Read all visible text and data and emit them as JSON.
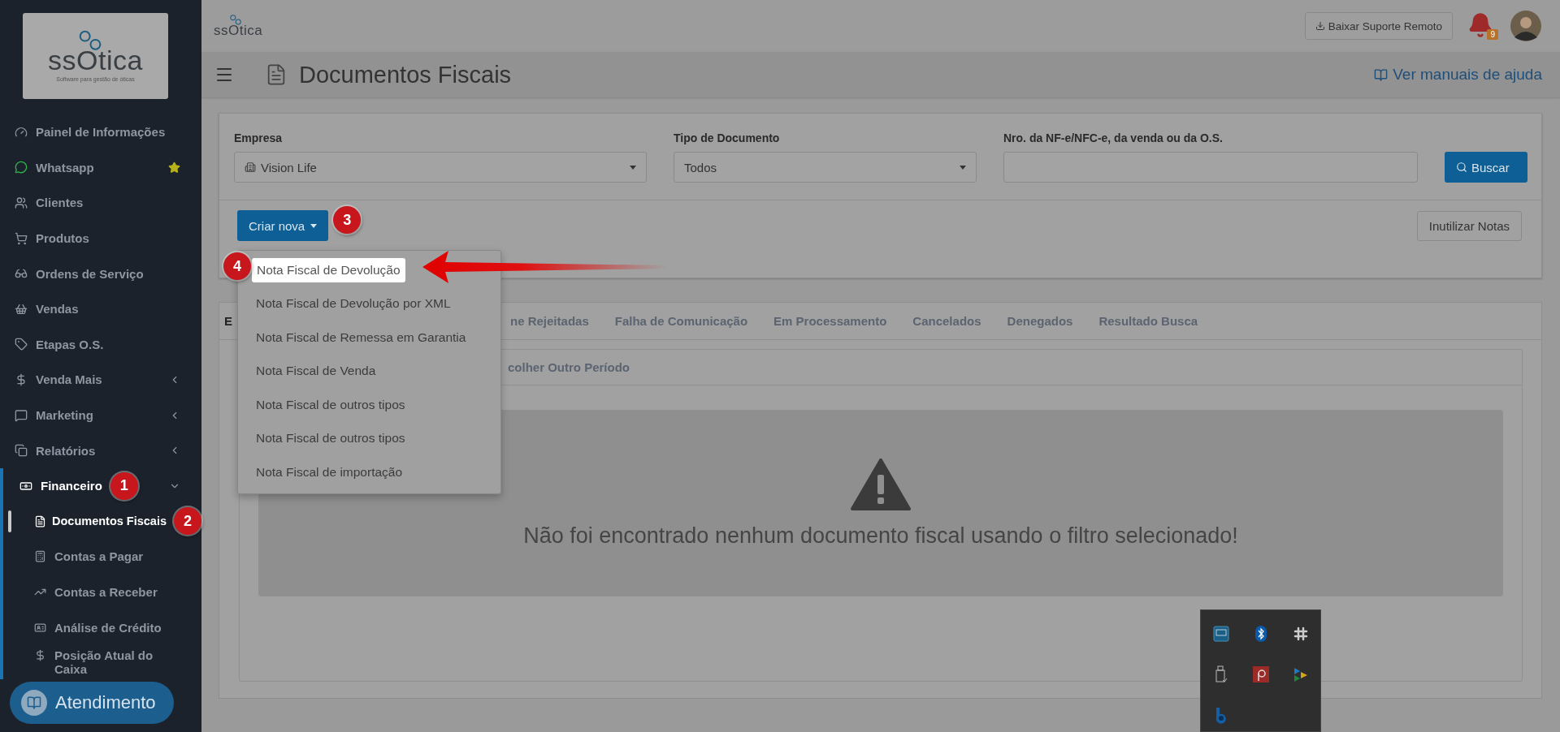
{
  "sidebar": {
    "logo": {
      "name": "ssOtica",
      "tagline": "Software para gestão de óticas"
    },
    "items": [
      {
        "label": "Painel de Informações",
        "selected": false
      },
      {
        "label": "Whatsapp",
        "starred": true,
        "selected": false
      },
      {
        "label": "Clientes",
        "selected": false
      },
      {
        "label": "Produtos",
        "selected": false
      },
      {
        "label": "Ordens de Serviço",
        "selected": false
      },
      {
        "label": "Vendas",
        "selected": false
      },
      {
        "label": "Etapas O.S.",
        "selected": false
      },
      {
        "label": "Venda Mais",
        "expanded": false,
        "selected": false
      },
      {
        "label": "Marketing",
        "expanded": false,
        "selected": false
      },
      {
        "label": "Relatórios",
        "expanded": false,
        "selected": false
      },
      {
        "label": "Financeiro",
        "expanded": true,
        "selected": true,
        "step": "1",
        "children": [
          {
            "label": "Documentos Fiscais",
            "selected": true,
            "step": "2"
          },
          {
            "label": "Contas a Pagar",
            "selected": false
          },
          {
            "label": "Contas a Receber",
            "selected": false
          },
          {
            "label": "Análise de Crédito",
            "selected": false
          },
          {
            "label": "Posição Atual do Caixa",
            "selected": false
          }
        ]
      }
    ],
    "support_button": "Atendimento"
  },
  "topbar": {
    "logo": "ssOtica",
    "remote_support": "Baixar Suporte Remoto",
    "notifications": "9"
  },
  "page_header": {
    "title": "Documentos Fiscais",
    "help_link": "Ver manuais de ajuda"
  },
  "filters": {
    "fields": [
      {
        "label": "Empresa",
        "kind": "select",
        "value": "Vision Life"
      },
      {
        "label": "Tipo de Documento",
        "kind": "select",
        "value": "Todos"
      },
      {
        "label": "Nro. da NF-e/NFC-e, da venda ou da O.S.",
        "kind": "text"
      }
    ],
    "search_button": "Buscar",
    "create_button": {
      "label": "Criar nova",
      "step": "3"
    },
    "void_button": "Inutilizar Notas"
  },
  "create_menu": [
    {
      "label": "Nota Fiscal de Devolução",
      "selected": true,
      "step": "4"
    },
    {
      "label": "Nota Fiscal de Devolução por XML",
      "selected": false
    },
    {
      "label": "Nota Fiscal de Remessa em Garantia",
      "selected": false
    },
    {
      "label": "Nota Fiscal de Venda",
      "selected": false
    },
    {
      "label": "Nota Fiscal de outros tipos",
      "selected": false
    },
    {
      "label": "Nota Fiscal de outros tipos",
      "selected": false
    },
    {
      "label": "Nota Fiscal de importação",
      "selected": false
    }
  ],
  "tabs": [
    {
      "label": "E",
      "selected": true
    },
    {
      "label": "ne Rejeitadas",
      "selected": false
    },
    {
      "label": "Falha de Comunicação",
      "selected": false
    },
    {
      "label": "Em Processamento",
      "selected": false
    },
    {
      "label": "Cancelados",
      "selected": false
    },
    {
      "label": "Denegados",
      "selected": false
    },
    {
      "label": "Resultado Busca",
      "selected": false
    }
  ],
  "period_tab": "colher Outro Período",
  "empty_message": "Não foi encontrado nenhum documento fiscal usando o filtro selecionado!"
}
